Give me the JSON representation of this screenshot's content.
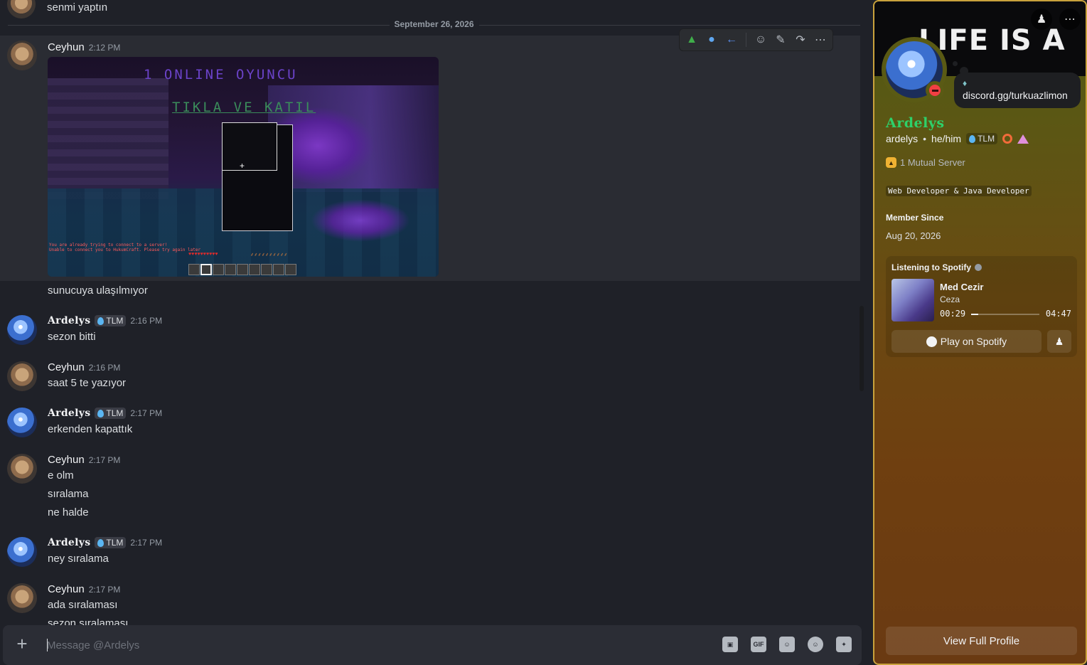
{
  "chat": {
    "clipped_line": "senmi yaptın",
    "date_divider": "September 26, 2026",
    "toolbar_icons": [
      "dinosaur-emoji-icon",
      "cold-face-emoji-icon",
      "left-arrow-emoji-icon",
      "add-reaction-icon",
      "edit-icon",
      "forward-icon",
      "more-icon"
    ],
    "messages": [
      {
        "author": "Ceyhun",
        "time": "2:12 PM",
        "lines": [
          "sunucuya ulaşılmıyor"
        ]
      },
      {
        "author": "Ardelys",
        "tag": "TLM",
        "time": "2:16 PM",
        "lines": [
          "sezon bitti"
        ]
      },
      {
        "author": "Ceyhun",
        "time": "2:16 PM",
        "lines": [
          "saat 5 te yazıyor"
        ]
      },
      {
        "author": "Ardelys",
        "tag": "TLM",
        "time": "2:17 PM",
        "lines": [
          "erkenden kapattık"
        ]
      },
      {
        "author": "Ceyhun",
        "time": "2:17 PM",
        "lines": [
          "e olm",
          "sıralama",
          "ne halde"
        ]
      },
      {
        "author": "Ardelys",
        "tag": "TLM",
        "time": "2:17 PM",
        "lines": [
          "ney sıralama"
        ]
      },
      {
        "author": "Ceyhun",
        "time": "2:17 PM",
        "lines": [
          "ada sıralaması",
          "sezon sıralaması"
        ]
      }
    ],
    "screenshot": {
      "line1": "1 ONLINE OYUNCU",
      "line2": "TIKLA VE KATIL",
      "error1": "You are already trying to connect to a server!",
      "error2": "Unable to connect you to HukumCraft. Please try again later",
      "hearts": "♥♥♥♥♥♥♥♥♥♥",
      "food": "⸙⸙⸙⸙⸙⸙⸙⸙⸙⸙"
    }
  },
  "composer": {
    "placeholder": "Message @Ardelys",
    "icons": [
      "gift-icon",
      "gif-icon",
      "sticker-icon",
      "emoji-icon",
      "apps-icon"
    ],
    "gif_label": "GIF"
  },
  "profile": {
    "banner_text": "LIFE IS A",
    "custom_status": "discord.gg/turkuazlimon",
    "display_name": "Ardelys",
    "username": "ardelys",
    "separator": "•",
    "pronouns": "he/him",
    "guild_tag": "TLM",
    "mutual": "1 Mutual Server",
    "bio": "Web Developer & Java Developer",
    "member_since_label": "Member Since",
    "member_since": "Aug 20, 2026",
    "spotify": {
      "label": "Listening to Spotify",
      "song": "Med Cezir",
      "artist": "Ceza",
      "current": "00:29",
      "duration": "04:47",
      "progress": 0.101,
      "play_label": "Play on Spotify"
    },
    "view_full": "View Full Profile",
    "accent": "#c9a23c",
    "display_name_color": "#2ed06a"
  }
}
